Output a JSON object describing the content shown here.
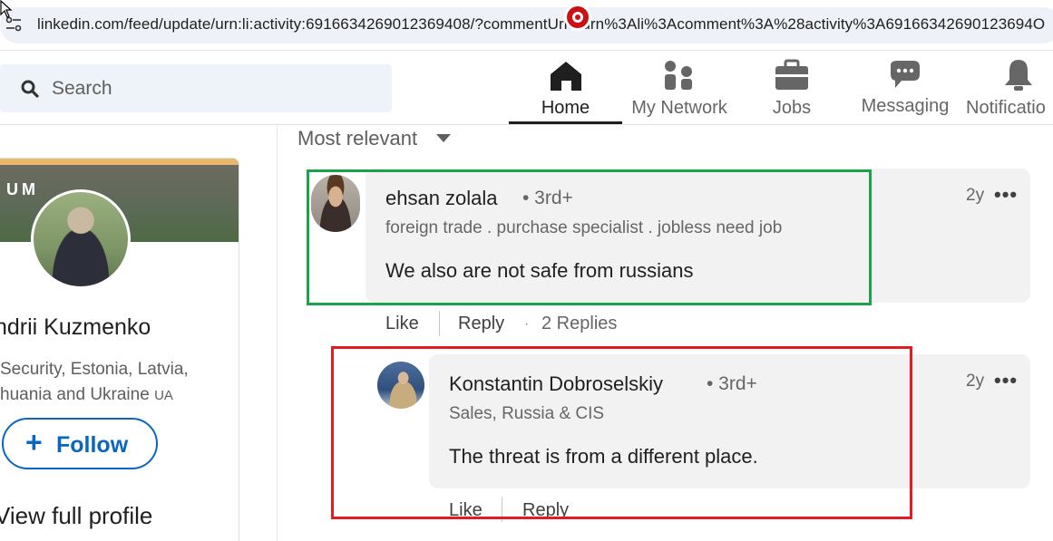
{
  "browser": {
    "url": "linkedin.com/feed/update/urn:li:activity:6916634269012369408/?commentUrn=urn%3Ali%3Acomment%3A%28activity%3A69166342690123694O"
  },
  "nav": {
    "search_placeholder": "Search",
    "items": [
      {
        "label": "Home",
        "icon": "home-icon"
      },
      {
        "label": "My Network",
        "icon": "network-icon"
      },
      {
        "label": "Jobs",
        "icon": "briefcase-icon"
      },
      {
        "label": "Messaging",
        "icon": "messaging-icon"
      },
      {
        "label": "Notificatio",
        "icon": "bell-icon"
      }
    ]
  },
  "profile": {
    "banner_text": "UM",
    "name": "ndrii Kuzmenko",
    "desc_line1": "Security, Estonia, Latvia,",
    "desc_line2": "huania and Ukraine",
    "desc_flag": "UA",
    "follow_label": "Follow",
    "view_profile": "View full profile"
  },
  "comments": {
    "sort_label": "Most relevant",
    "items": [
      {
        "author": "ehsan zolala",
        "degree": "• 3rd+",
        "headline": "foreign trade . purchase specialist . jobless need job",
        "text": "We also are not safe from russians",
        "time": "2y",
        "like": "Like",
        "reply": "Reply",
        "replies": "2 Replies"
      },
      {
        "author": "Konstantin Dobroselskiy",
        "degree": "• 3rd+",
        "headline": "Sales, Russia & CIS",
        "text": "The threat is from a different place.",
        "time": "2y",
        "like": "Like",
        "reply": "Reply"
      }
    ]
  },
  "colors": {
    "highlight_green": "#1aa34a",
    "highlight_red": "#e31b23",
    "linkedin_blue": "#0a66c2"
  }
}
